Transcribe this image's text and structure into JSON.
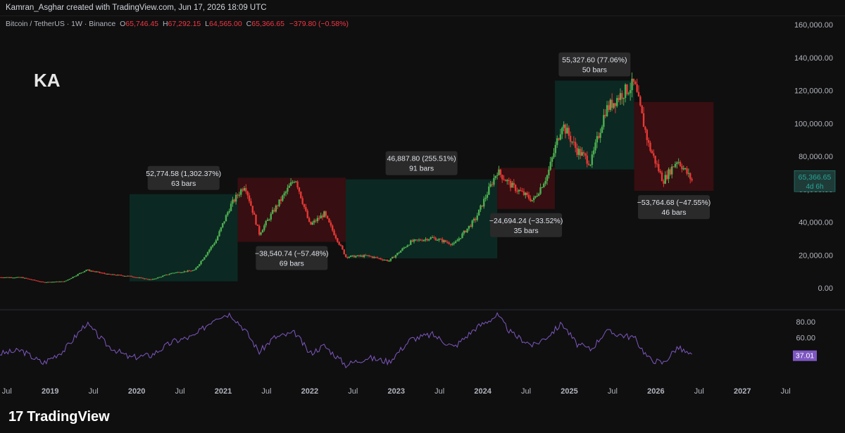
{
  "header": {
    "credit": "Kamran_Asghar created with TradingView.com, Jun 17, 2026 18:09 UTC"
  },
  "legend": {
    "symbol": "Bitcoin / TetherUS · 1W · Binance",
    "o_label": "O",
    "o_value": "65,746.45",
    "h_label": "H",
    "h_value": "67,292.15",
    "l_label": "L",
    "l_value": "64,565.00",
    "c_label": "C",
    "c_value": "65,366.65",
    "change": "−379.80 (−0.58%)"
  },
  "watermark": {
    "letters": "KA"
  },
  "footer": {
    "brand": "TradingView",
    "logo_mark": "17"
  },
  "colors": {
    "up": "#26a69a",
    "down": "#ef5350",
    "candle_up": "#4caf50",
    "candle_down": "#e53935",
    "rsi": "#7e57c2",
    "bull_box": "#0d2a24",
    "bear_box": "#3a0f12"
  },
  "chart_data": [
    {
      "type": "candlestick",
      "title": "",
      "x_ticks": [
        "Jul",
        "2019",
        "Jul",
        "2020",
        "Jul",
        "2021",
        "Jul",
        "2022",
        "Jul",
        "2023",
        "Jul",
        "2024",
        "Jul",
        "2025",
        "Jul",
        "2026",
        "Jul",
        "2027",
        "Jul"
      ],
      "y_ticks": [
        "160,000.00",
        "140,000.00",
        "120,000.00",
        "100,000.00",
        "80,000.00",
        "60,000.00",
        "40,000.00",
        "20,000.00",
        "0.00"
      ],
      "ylim": [
        0,
        160000
      ],
      "last_price": "65,366.65",
      "countdown": "4d 6h",
      "price_path": [
        [
          "2018-06",
          6500
        ],
        [
          "2018-09",
          6400
        ],
        [
          "2018-12",
          3500
        ],
        [
          "2019-03",
          4000
        ],
        [
          "2019-06",
          11000
        ],
        [
          "2019-09",
          8300
        ],
        [
          "2019-12",
          7200
        ],
        [
          "2020-03",
          5000
        ],
        [
          "2020-06",
          9200
        ],
        [
          "2020-09",
          10700
        ],
        [
          "2020-12",
          29000
        ],
        [
          "2021-02",
          50000
        ],
        [
          "2021-04",
          63000
        ],
        [
          "2021-06",
          33000
        ],
        [
          "2021-08",
          47000
        ],
        [
          "2021-11",
          67000
        ],
        [
          "2022-01",
          38000
        ],
        [
          "2022-03",
          45000
        ],
        [
          "2022-06",
          19000
        ],
        [
          "2022-09",
          19500
        ],
        [
          "2022-12",
          16500
        ],
        [
          "2023-03",
          28000
        ],
        [
          "2023-06",
          30500
        ],
        [
          "2023-09",
          26500
        ],
        [
          "2023-12",
          42000
        ],
        [
          "2024-03",
          71000
        ],
        [
          "2024-05",
          62000
        ],
        [
          "2024-08",
          53000
        ],
        [
          "2024-10",
          69000
        ],
        [
          "2024-12",
          100000
        ],
        [
          "2025-02",
          84000
        ],
        [
          "2025-04",
          76000
        ],
        [
          "2025-06",
          108000
        ],
        [
          "2025-08",
          117000
        ],
        [
          "2025-10",
          124000
        ],
        [
          "2025-12",
          87000
        ],
        [
          "2026-02",
          65000
        ],
        [
          "2026-04",
          78000
        ],
        [
          "2026-06",
          65366
        ]
      ],
      "measurements": [
        {
          "kind": "bull",
          "from": "2019-12",
          "to": "2021-03",
          "low": 4000,
          "high": 57000,
          "label": "52,774.58 (1,302.37%)",
          "bars": "63 bars"
        },
        {
          "kind": "bear",
          "from": "2021-03",
          "to": "2022-06",
          "low": 28000,
          "high": 67000,
          "label": "−38,540.74 (−57.48%)",
          "bars": "69 bars"
        },
        {
          "kind": "bull",
          "from": "2022-06",
          "to": "2024-03",
          "low": 18000,
          "high": 66000,
          "label": "46,887.80 (255.51%)",
          "bars": "91 bars"
        },
        {
          "kind": "bear",
          "from": "2024-03",
          "to": "2024-11",
          "low": 48000,
          "high": 73000,
          "label": "−24,694.24 (−33.52%)",
          "bars": "35 bars"
        },
        {
          "kind": "bull",
          "from": "2024-11",
          "to": "2025-10",
          "low": 72000,
          "high": 126000,
          "label": "55,327.60 (77.06%)",
          "bars": "50 bars"
        },
        {
          "kind": "bear",
          "from": "2025-10",
          "to": "2026-09",
          "low": 59000,
          "high": 113000,
          "label": "−53,764.68 (−47.55%)",
          "bars": "46 bars"
        }
      ]
    },
    {
      "type": "line",
      "title": "",
      "y_ticks": [
        "80.00",
        "60.00",
        "40.00"
      ],
      "ylim": [
        20,
        95
      ],
      "last_value": "37.01",
      "rsi_path": [
        [
          "2018-06",
          40
        ],
        [
          "2018-09",
          44
        ],
        [
          "2018-12",
          28
        ],
        [
          "2019-03",
          45
        ],
        [
          "2019-06",
          78
        ],
        [
          "2019-09",
          50
        ],
        [
          "2019-12",
          35
        ],
        [
          "2020-03",
          38
        ],
        [
          "2020-06",
          55
        ],
        [
          "2020-09",
          62
        ],
        [
          "2020-12",
          86
        ],
        [
          "2021-02",
          90
        ],
        [
          "2021-04",
          70
        ],
        [
          "2021-06",
          42
        ],
        [
          "2021-08",
          60
        ],
        [
          "2021-11",
          66
        ],
        [
          "2022-01",
          40
        ],
        [
          "2022-03",
          50
        ],
        [
          "2022-06",
          26
        ],
        [
          "2022-09",
          35
        ],
        [
          "2022-12",
          30
        ],
        [
          "2023-03",
          58
        ],
        [
          "2023-06",
          64
        ],
        [
          "2023-09",
          48
        ],
        [
          "2023-12",
          72
        ],
        [
          "2024-03",
          88
        ],
        [
          "2024-05",
          65
        ],
        [
          "2024-08",
          50
        ],
        [
          "2024-10",
          62
        ],
        [
          "2024-12",
          78
        ],
        [
          "2025-02",
          52
        ],
        [
          "2025-04",
          45
        ],
        [
          "2025-06",
          68
        ],
        [
          "2025-08",
          64
        ],
        [
          "2025-10",
          60
        ],
        [
          "2025-12",
          34
        ],
        [
          "2026-02",
          28
        ],
        [
          "2026-04",
          48
        ],
        [
          "2026-06",
          37
        ]
      ]
    }
  ]
}
